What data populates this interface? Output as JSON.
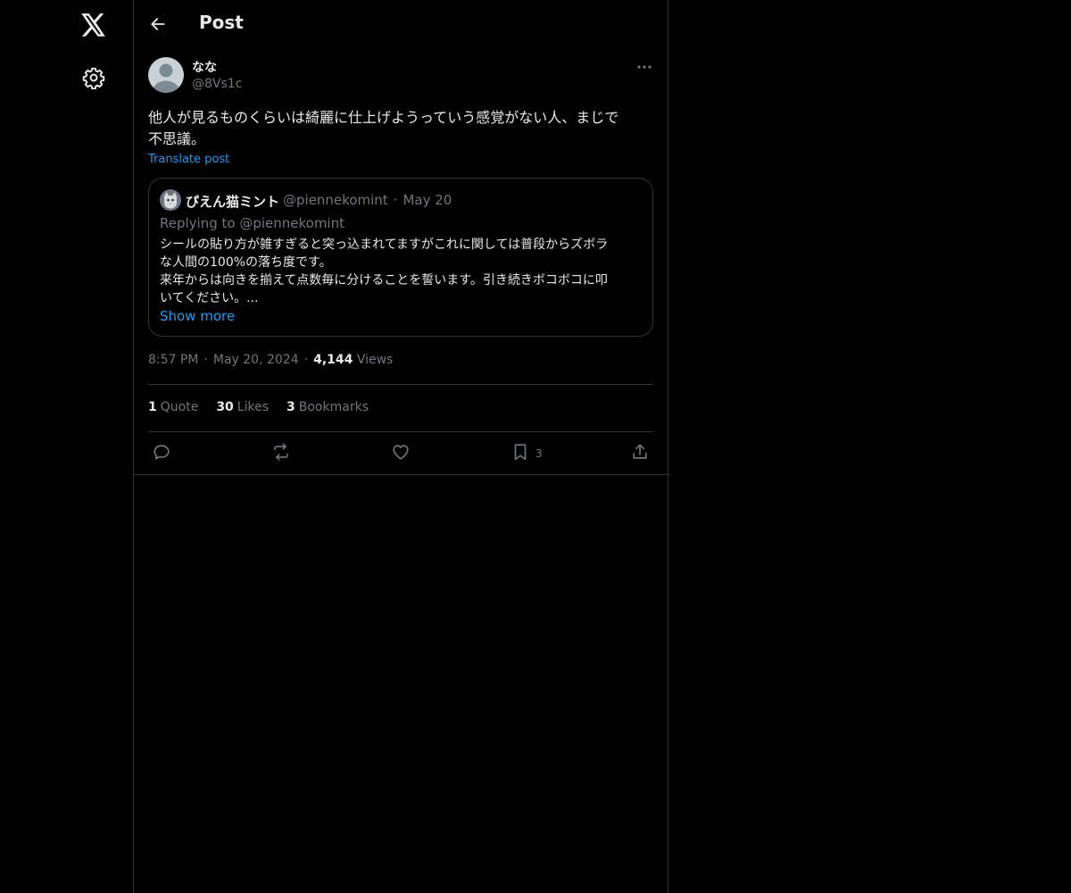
{
  "header": {
    "title": "Post"
  },
  "post": {
    "display_name": "なな",
    "handle": "@8Vs1c",
    "text": "他人が見るものくらいは綺麗に仕上げようっていう感覚がない人、まじで\n不思議。",
    "translate_label": "Translate post",
    "quote": {
      "display_name": "ぴえん猫ミント",
      "handle": "@piennekomint",
      "separator": "·",
      "date": "May 20",
      "replying_to": "Replying to @piennekomint",
      "text": "シールの貼り方が雑すぎると突っ込まれてますがこれに関しては普段からズボラ\nな人間の100%の落ち度です。\n来年からは向きを揃えて点数毎に分けることを誓います。引き続きボコボコに叩\nいてください。...",
      "show_more": "Show more"
    },
    "time": "8:57 PM",
    "separator": "·",
    "date": "May 20, 2024",
    "views_count": "4,144",
    "views_label": "Views",
    "stats": {
      "quotes_count": "1",
      "quotes_label": "Quote",
      "likes_count": "30",
      "likes_label": "Likes",
      "bookmarks_count": "3",
      "bookmarks_label": "Bookmarks"
    },
    "actions": {
      "bookmark_count": "3"
    }
  },
  "icons": [
    "x-logo-icon",
    "gear-icon",
    "back-arrow-icon",
    "more-icon",
    "reply-icon",
    "repost-icon",
    "like-icon",
    "bookmark-icon",
    "share-icon"
  ],
  "colors": {
    "background": "#000000",
    "text": "#e7e9ea",
    "muted": "#71767b",
    "accent": "#1d9bf0",
    "border": "#2f3336"
  }
}
